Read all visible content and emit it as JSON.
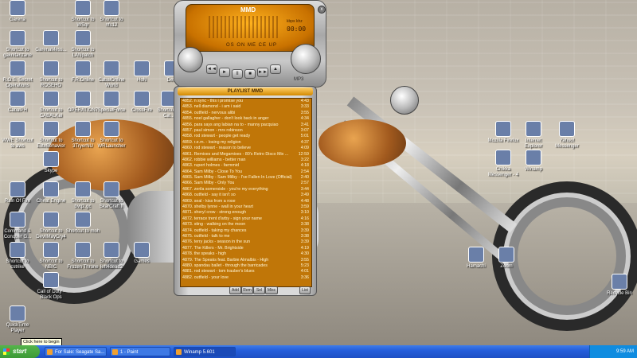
{
  "desktop_icons": [
    {
      "label": "Garena",
      "x": 0
    },
    {
      "label": "Shortcut to WSqr",
      "x": 0
    },
    {
      "label": "Shortcut to nfs12",
      "x": 0
    },
    {
      "label": "Shortcut to gaknitarizane",
      "x": 0
    },
    {
      "label": "GarenaMess...",
      "x": 0
    },
    {
      "label": "Shortcut to LANpatch",
      "x": 0
    },
    {
      "label": "R.O.S. Secret Operations",
      "x": 0
    },
    {
      "label": "Shortcut to ROSEHO",
      "x": 0
    },
    {
      "label": "F.R.Online",
      "x": 0
    },
    {
      "label": "CabalOnline World",
      "x": 0
    },
    {
      "label": "HoN",
      "x": 0
    },
    {
      "label": "Dete",
      "x": 0
    },
    {
      "label": "CabalPH",
      "x": 0
    },
    {
      "label": "Shortcut to CABALKai",
      "x": 0
    },
    {
      "label": "OPERATION7",
      "x": 0
    },
    {
      "label": "SpecialForce",
      "x": 0
    },
    {
      "label": "CrossFire",
      "x": 0
    },
    {
      "label": "Shortcut to Cal...",
      "x": 0
    },
    {
      "label": "WWE Shortcut to aws",
      "x": 0
    },
    {
      "label": "Shortcut to EliteBehavior",
      "x": 0
    },
    {
      "label": "Shortcut to 3TryerNU",
      "x": 0
    },
    {
      "label": "Shortcut to WRLauncher",
      "x": 0
    },
    {
      "label": "Skype",
      "x": 0
    },
    {
      "label": "Rain Of Fire",
      "x": 0
    },
    {
      "label": "Cheat Engine",
      "x": 0
    },
    {
      "label": "Shortcut to bvq2.gc",
      "x": 0
    },
    {
      "label": "Shortcut to SkarCraft II",
      "x": 0
    },
    {
      "label": "Command & Conquer G...",
      "x": 0
    },
    {
      "label": "Shortcut to DevilMayCry4",
      "x": 0
    },
    {
      "label": "Shortcut to moh",
      "x": 0
    },
    {
      "label": "Shortcut to cstrike",
      "x": 0
    },
    {
      "label": "Shortcut to NBIC",
      "x": 0
    },
    {
      "label": "Shortcut to Frozen Throne",
      "x": 0
    },
    {
      "label": "Shortcut to left4dead2",
      "x": 0
    },
    {
      "label": "Games",
      "x": 0
    },
    {
      "label": "Call of Duty - Black Ops",
      "x": 0
    },
    {
      "label": "QuickTime Player",
      "x": 0
    },
    {
      "label": "Mozilla Firefox",
      "x": 0
    },
    {
      "label": "Internet Explorer",
      "x": 0
    },
    {
      "label": "Yahoo! Messenger",
      "x": 0
    },
    {
      "label": "Chikka Messenger - 4",
      "x": 0
    },
    {
      "label": "Winamp",
      "x": 0
    },
    {
      "label": "Hamachi",
      "x": 0
    },
    {
      "label": "Zoom",
      "x": 0
    },
    {
      "label": "Recycle Bin",
      "x": 0
    }
  ],
  "winamp": {
    "logo": "MMD",
    "time": "00:00",
    "kbps": "kbps khz",
    "ticker": "OS ON ME CE UP",
    "buttons": [
      "◄◄",
      "►",
      "II",
      "■",
      "►►",
      "▲"
    ],
    "footer": "MP3",
    "side": "x"
  },
  "playlist": {
    "title": "PLAYLIST  MMD",
    "tracks": [
      {
        "t": "4852. n sync - this i promise you",
        "d": "4:43"
      },
      {
        "t": "4853. nell diamond                  - i am i said",
        "d": "3:33"
      },
      {
        "t": "4854. outfield - nervous alibi",
        "d": "3:55"
      },
      {
        "t": "4855. noel gallagher - don't look back in anger",
        "d": "4:34"
      },
      {
        "t": "4856. para says ang labian na to - manny pacquiao",
        "d": "3:41"
      },
      {
        "t": "4857. paul simon - mrs robinson",
        "d": "3:07"
      },
      {
        "t": "4858. rod stewart - people get ready",
        "d": "5:01"
      },
      {
        "t": "4859. r.e.m. - losing my religion",
        "d": "4:37"
      },
      {
        "t": "4860. rod stewart - reason to believe",
        "d": "4:09"
      },
      {
        "t": "4861. Remixes and Megamixes - 80's Retro Disco Mix ...",
        "d": "12:59"
      },
      {
        "t": "4862. robbie williams - better man",
        "d": "3:22"
      },
      {
        "t": "4863. rupert holmes                   - farmmid",
        "d": "4:18"
      },
      {
        "t": "4864. Sam Milby - Close To You",
        "d": "2:54"
      },
      {
        "t": "4865. Sam Milby - Sam Milby - I've Fallen In Love (Official)",
        "d": "2:40"
      },
      {
        "t": "4866. Sam Milby - Only You",
        "d": "2:57"
      },
      {
        "t": "4867. zerila somersisle                  - you're my everything",
        "d": "3:44"
      },
      {
        "t": "4868. outfield - say it isn't so",
        "d": "3:49"
      },
      {
        "t": "4869. seal - kiss from a rose",
        "d": "4:48"
      },
      {
        "t": "4870. shelby lynne - wall in your heart",
        "d": "3:59"
      },
      {
        "t": "4871. sheryl crow - strong enough",
        "d": "3:10"
      },
      {
        "t": "4872. terrace trent d'arby - sign your name",
        "d": "4:16"
      },
      {
        "t": "4873. sting - walking on the moon",
        "d": "3:38"
      },
      {
        "t": "4874. outfield - taking my chances",
        "d": "3:39"
      },
      {
        "t": "4875. outfield - talk to me",
        "d": "3:38"
      },
      {
        "t": "4876. terry jacks                   - season in the sun",
        "d": "3:39"
      },
      {
        "t": "4877. The Killers - Mr. Brightside",
        "d": "4:19"
      },
      {
        "t": "4878. the speaks - high",
        "d": "4:30"
      },
      {
        "t": "4879. The Speaks feat. Barbie Almalbis - High",
        "d": "3:55"
      },
      {
        "t": "4880. spandau ballet - through the barricades",
        "d": "5:23"
      },
      {
        "t": "4881. rod stewart - tom trauber's blues",
        "d": "4:01"
      },
      {
        "t": "4882. outfield - your love",
        "d": "3:36"
      }
    ],
    "buttons": [
      "Add",
      "Rem",
      "Sel",
      "Misc",
      "List"
    ]
  },
  "taskbar": {
    "start": "start",
    "tasks": [
      "For Sale: Seagate Sa...",
      "1 - Paint",
      "Winamp 5.601"
    ],
    "clock": "9:59 AM"
  },
  "tooltip": "Click here to begin"
}
